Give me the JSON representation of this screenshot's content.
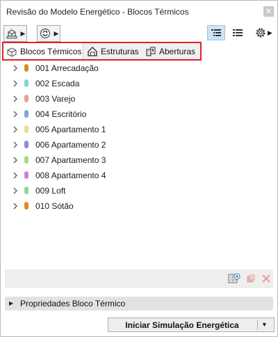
{
  "window": {
    "title": "Revisão do Modelo Energético - Blocos Térmicos",
    "close_glyph": "✕"
  },
  "toolbar": {
    "dropdown_arrow": "▶",
    "icons": [
      "model-3d-icon",
      "refresh-icon",
      "tree-view-icon",
      "list-view-icon",
      "settings-icon"
    ],
    "active_view": "tree-view"
  },
  "tabs": [
    {
      "label": "Blocos Térmicos",
      "icon": "block-icon",
      "active": true
    },
    {
      "label": "Estruturas",
      "icon": "house-icon",
      "active": false
    },
    {
      "label": "Aberturas",
      "icon": "openings-icon",
      "active": false
    }
  ],
  "blocks": [
    {
      "label": "001 Arrecadação",
      "color": "#e08a1e"
    },
    {
      "label": "002 Escada",
      "color": "#7fd6d8"
    },
    {
      "label": "003 Varejo",
      "color": "#e4a28e"
    },
    {
      "label": "004 Escritório",
      "color": "#7fa6db"
    },
    {
      "label": "005 Apartamento 1",
      "color": "#e8df8a"
    },
    {
      "label": "006 Apartamento 2",
      "color": "#8e86d6"
    },
    {
      "label": "007 Apartamento 3",
      "color": "#a7de72"
    },
    {
      "label": "008 Apartamento 4",
      "color": "#cf80d8"
    },
    {
      "label": "009 Loft",
      "color": "#8ddb8f"
    },
    {
      "label": "010 Sótão",
      "color": "#e08a1e"
    }
  ],
  "list_actions": [
    "add-block-icon",
    "merge-icon",
    "delete-icon"
  ],
  "properties": {
    "arrow": "▶",
    "label": "Propriedades Bloco Térmico"
  },
  "run": {
    "label": "Iniciar Simulação Energética",
    "dropdown_arrow": "▼"
  }
}
